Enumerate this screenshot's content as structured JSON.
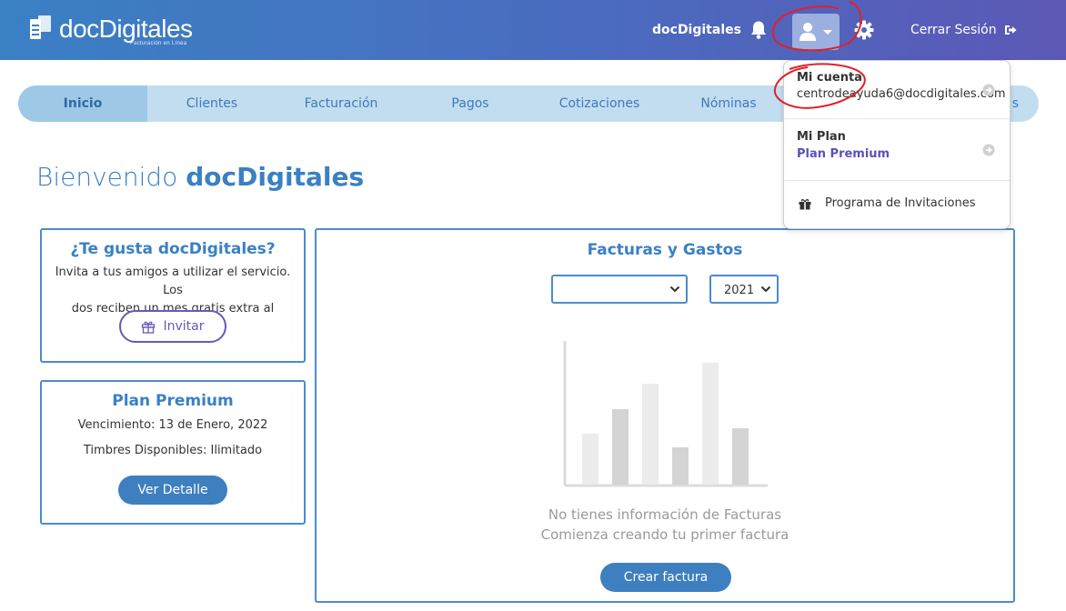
{
  "header": {
    "logo_text_light": "doc",
    "logo_text_bold": "Digitales",
    "logo_sub": "Facturación en Línea",
    "company": "docDigitales",
    "logout_label": "Cerrar Sesión"
  },
  "nav": {
    "items": [
      {
        "label": "Inicio",
        "active": true
      },
      {
        "label": "Clientes"
      },
      {
        "label": "Facturación"
      },
      {
        "label": "Pagos"
      },
      {
        "label": "Cotizaciones"
      },
      {
        "label": "Nóminas"
      },
      {
        "label": ""
      },
      {
        "label": "s"
      }
    ]
  },
  "welcome": {
    "prefix": "Bienvenido",
    "name": "docDigitales"
  },
  "invite_card": {
    "title": "¿Te gusta docDigitales?",
    "text_line1": "Invita a tus amigos a utilizar el servicio. Los",
    "text_line2": "dos reciben un mes gratis extra al contratar.",
    "button": "Invitar"
  },
  "plan_card": {
    "title": "Plan Premium",
    "expiry": "Vencimiento: 13 de Enero, 2022",
    "stamps": "Timbres Disponibles: Ilimitado",
    "button": "Ver Detalle"
  },
  "chart_card": {
    "title": "Facturas y Gastos",
    "month_select": "",
    "year_select": "2021",
    "empty_line1": "No tienes información de Facturas",
    "empty_line2": "Comienza creando tu primer factura",
    "button": "Crear factura"
  },
  "dropdown": {
    "account_title": "Mi cuenta",
    "account_email": "centrodeayuda6@docdigitales.com",
    "plan_title": "Mi Plan",
    "plan_value": "Plan Premium",
    "invites": "Programa de Invitaciones"
  },
  "colors": {
    "header_start": "#3a80c4",
    "header_end": "#5c58b6",
    "accent": "#3a80c4",
    "invite_purple": "#6a58b8",
    "annotation_red": "#e0202a"
  },
  "icons": [
    "bell-icon",
    "user-icon",
    "caret-down-icon",
    "gear-icon",
    "logout-icon",
    "gift-icon",
    "arrow-right-circle-icon",
    "chevron-down-icon"
  ]
}
